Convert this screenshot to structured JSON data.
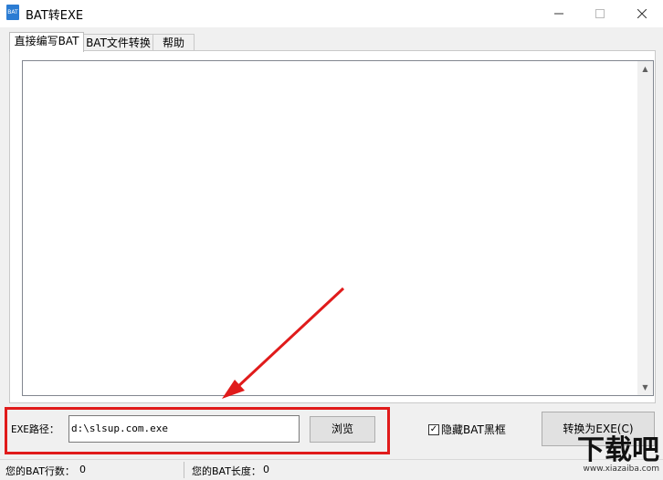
{
  "window": {
    "title": "BAT转EXE",
    "icon_name": "bat-file-icon",
    "icon_text": "BAT"
  },
  "titlebar_controls": [
    "minimize-icon",
    "maximize-icon",
    "close-icon"
  ],
  "tabs": [
    {
      "label": "直接编写BAT",
      "active": true
    },
    {
      "label": "BAT文件转换",
      "active": false
    },
    {
      "label": "帮助",
      "active": false
    }
  ],
  "editor": {
    "value": ""
  },
  "exe_path": {
    "label": "EXE路径：",
    "value": "d:\\slsup.com.exe"
  },
  "browse_button": {
    "label": "浏览"
  },
  "hide_console": {
    "label": "隐藏BAT黑框",
    "checked": true
  },
  "convert_button": {
    "label": "转换为EXE(C)"
  },
  "status": {
    "lines_label": "您的BAT行数：",
    "lines_value": "0",
    "length_label": "您的BAT长度：",
    "length_value": "0"
  },
  "watermark": {
    "main": "下载吧",
    "url": "www.xiazaiba.com"
  },
  "colors": {
    "highlight": "#e01b1b",
    "arrow": "#e01b1b",
    "window_bg": "#f0f0f0"
  }
}
